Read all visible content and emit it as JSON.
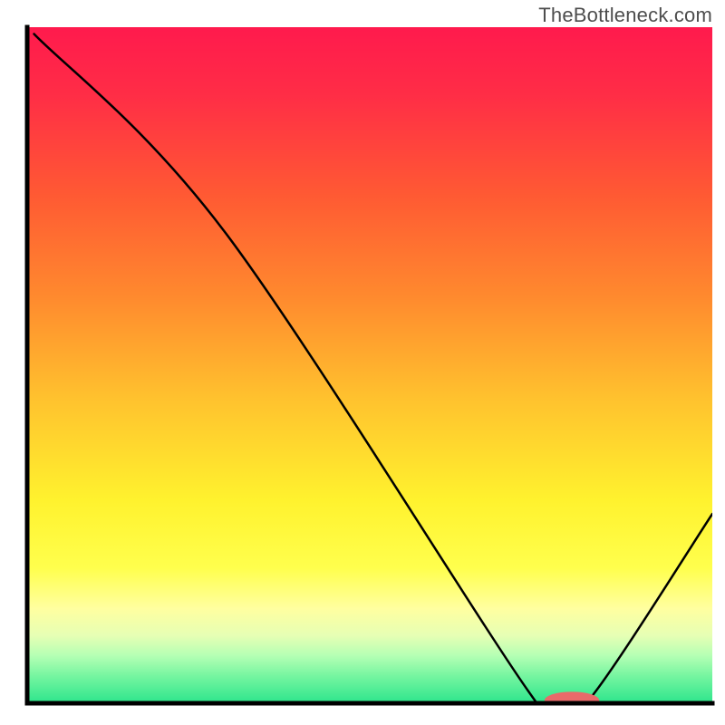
{
  "watermark": "TheBottleneck.com",
  "chart_data": {
    "type": "line",
    "title": "",
    "xlabel": "",
    "ylabel": "",
    "xlim": [
      0,
      100
    ],
    "ylim": [
      0,
      100
    ],
    "grid": false,
    "legend": false,
    "gradient_stops": [
      {
        "offset": 0.0,
        "color": "#ff1a4d"
      },
      {
        "offset": 0.1,
        "color": "#ff2d46"
      },
      {
        "offset": 0.25,
        "color": "#ff5a33"
      },
      {
        "offset": 0.4,
        "color": "#ff8a2e"
      },
      {
        "offset": 0.55,
        "color": "#ffc22e"
      },
      {
        "offset": 0.7,
        "color": "#fff22e"
      },
      {
        "offset": 0.8,
        "color": "#ffff4d"
      },
      {
        "offset": 0.86,
        "color": "#ffffa0"
      },
      {
        "offset": 0.9,
        "color": "#e6ffb4"
      },
      {
        "offset": 0.93,
        "color": "#b4ffb4"
      },
      {
        "offset": 0.96,
        "color": "#75f5a0"
      },
      {
        "offset": 1.0,
        "color": "#2de58c"
      }
    ],
    "axes_color": "#000000",
    "axes_width": 5,
    "series": [
      {
        "name": "bottleneck-curve",
        "color": "#000000",
        "width": 2.5,
        "x": [
          1,
          29,
          73,
          77,
          82,
          100
        ],
        "values": [
          99,
          69.5,
          2,
          0,
          0.5,
          28
        ]
      }
    ],
    "marker": {
      "name": "optimal-marker",
      "color": "#e96a6a",
      "cx": 79.5,
      "cy": 0.4,
      "rx": 4.0,
      "ry": 1.3
    }
  }
}
